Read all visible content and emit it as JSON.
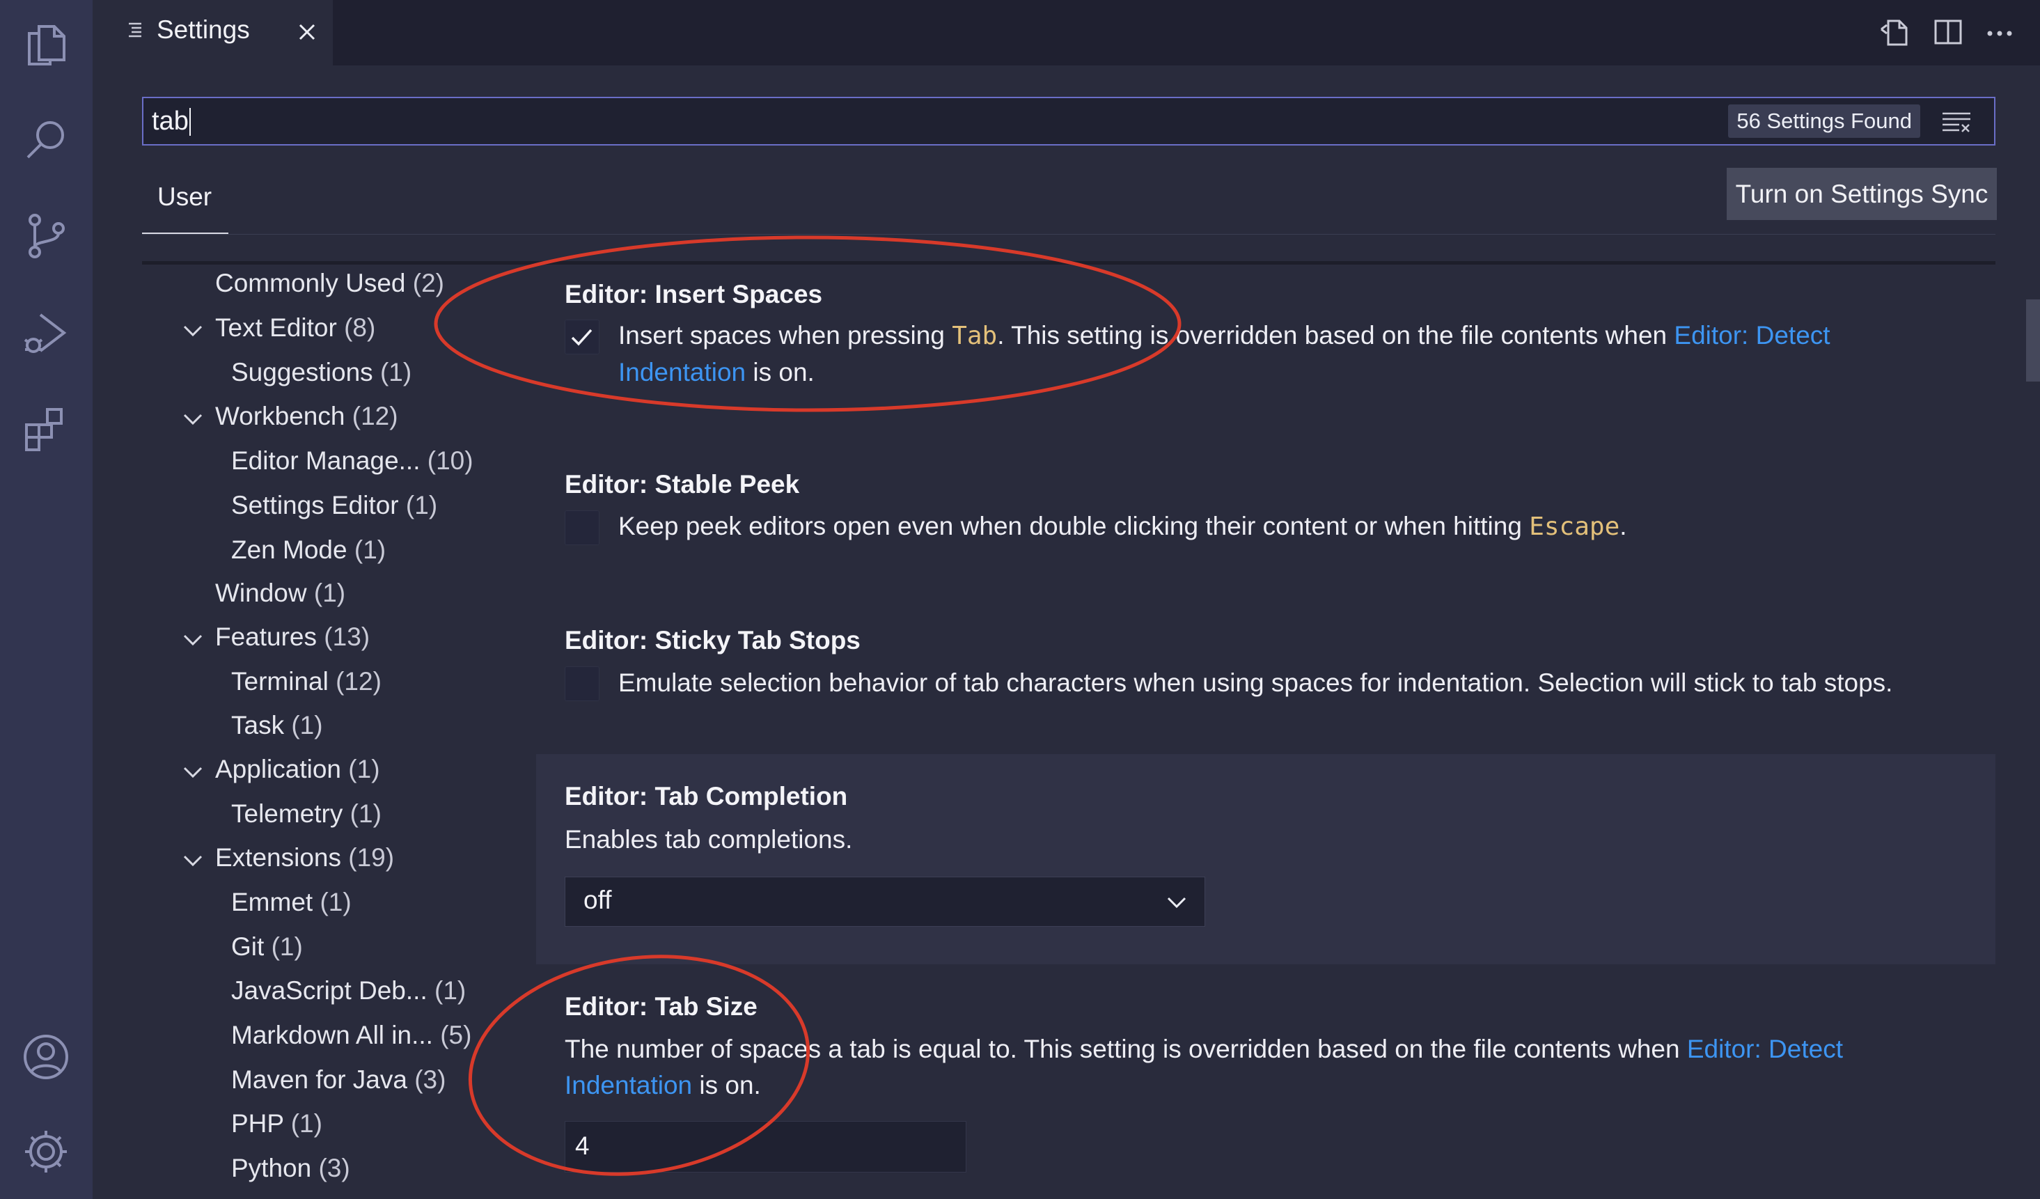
{
  "tab": {
    "title": "Settings"
  },
  "search": {
    "value": "tab",
    "results_badge": "56 Settings Found"
  },
  "scope": {
    "user_tab": "User",
    "sync_button": "Turn on Settings Sync"
  },
  "toc": [
    {
      "label": "Commonly Used",
      "count": "(2)"
    },
    {
      "label": "Text Editor",
      "count": "(8)"
    },
    {
      "label": "Suggestions",
      "count": "(1)"
    },
    {
      "label": "Workbench",
      "count": "(12)"
    },
    {
      "label": "Editor Manage...",
      "count": "(10)"
    },
    {
      "label": "Settings Editor",
      "count": "(1)"
    },
    {
      "label": "Zen Mode",
      "count": "(1)"
    },
    {
      "label": "Window",
      "count": "(1)"
    },
    {
      "label": "Features",
      "count": "(13)"
    },
    {
      "label": "Terminal",
      "count": "(12)"
    },
    {
      "label": "Task",
      "count": "(1)"
    },
    {
      "label": "Application",
      "count": "(1)"
    },
    {
      "label": "Telemetry",
      "count": "(1)"
    },
    {
      "label": "Extensions",
      "count": "(19)"
    },
    {
      "label": "Emmet",
      "count": "(1)"
    },
    {
      "label": "Git",
      "count": "(1)"
    },
    {
      "label": "JavaScript Deb...",
      "count": "(1)"
    },
    {
      "label": "Markdown All in...",
      "count": "(5)"
    },
    {
      "label": "Maven for Java",
      "count": "(3)"
    },
    {
      "label": "PHP",
      "count": "(1)"
    },
    {
      "label": "Python",
      "count": "(3)"
    }
  ],
  "settings": {
    "insert_spaces": {
      "title": "Editor: Insert Spaces",
      "checked": true,
      "desc_before": "Insert spaces when pressing ",
      "desc_code": "Tab",
      "desc_middle": ". This setting is overridden based on the file contents when ",
      "desc_link1": "Editor: Detect",
      "desc_link2": "Indentation",
      "desc_after": " is on."
    },
    "stable_peek": {
      "title": "Editor: Stable Peek",
      "checked": false,
      "desc_before": "Keep peek editors open even when double clicking their content or when hitting ",
      "desc_code": "Escape",
      "desc_after": "."
    },
    "sticky_tab_stops": {
      "title": "Editor: Sticky Tab Stops",
      "checked": false,
      "desc": "Emulate selection behavior of tab characters when using spaces for indentation. Selection will stick to tab stops."
    },
    "tab_completion": {
      "title": "Editor: Tab Completion",
      "desc": "Enables tab completions.",
      "value": "off"
    },
    "tab_size": {
      "title": "Editor: Tab Size",
      "desc_before": "The number of spaces a tab is equal to. This setting is overridden based on the file contents when ",
      "desc_link1": "Editor: Detect",
      "desc_link2": "Indentation",
      "desc_after": " is on.",
      "value": "4"
    }
  },
  "colors": {
    "accent_link": "#3d95f2",
    "code_text": "#e3c07a",
    "annotation_ring": "#d83a2a"
  }
}
